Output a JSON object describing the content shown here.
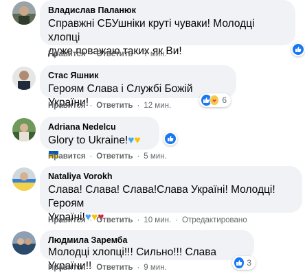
{
  "comments": [
    {
      "author": "Владислав Паланюк",
      "text_line1": "Справжні СБУшніки круті чуваки! Молодці хлопці",
      "text_line2": "дуже поважаю таких як Ви!",
      "like_label": "Нравится",
      "reply_label": "Ответить",
      "time": "7 мин.",
      "reaction_count": ""
    },
    {
      "author": "Стас Яшник",
      "text_line1": "Героям Слава і Службі Божій України!",
      "like_label": "Нравится",
      "reply_label": "Ответить",
      "time": "12 мин.",
      "reaction_count": "6"
    },
    {
      "author": "Adriana Nedelcu",
      "text_line1": "Glory to Ukraine!",
      "like_label": "Нравится",
      "reply_label": "Ответить",
      "time": "5 мин.",
      "reaction_count": ""
    },
    {
      "author": "Nataliya Vorokh",
      "text_line1": "Слава! Слава! Слава!Слава Україні! Молодці! Героям",
      "text_line2": "Україні!",
      "like_label": "Нравится",
      "reply_label": "Ответить",
      "time": "10 мин.",
      "edited_label": "Отредактировано",
      "reaction_count": ""
    },
    {
      "author": "Людмила Заремба",
      "text_line1": "Молодці хлопці!!! Сильно!!! Слава України!!",
      "like_label": "Нравится",
      "reply_label": "Ответить",
      "time": "9 мин.",
      "reaction_count": "3"
    }
  ],
  "icons": {
    "like": "like-icon",
    "care": "care-icon",
    "heart": "heart-emoji"
  },
  "colors": {
    "bubble": "#f0f2f5",
    "accent_blue": "#1877f2",
    "meta_gray": "#65676b"
  }
}
